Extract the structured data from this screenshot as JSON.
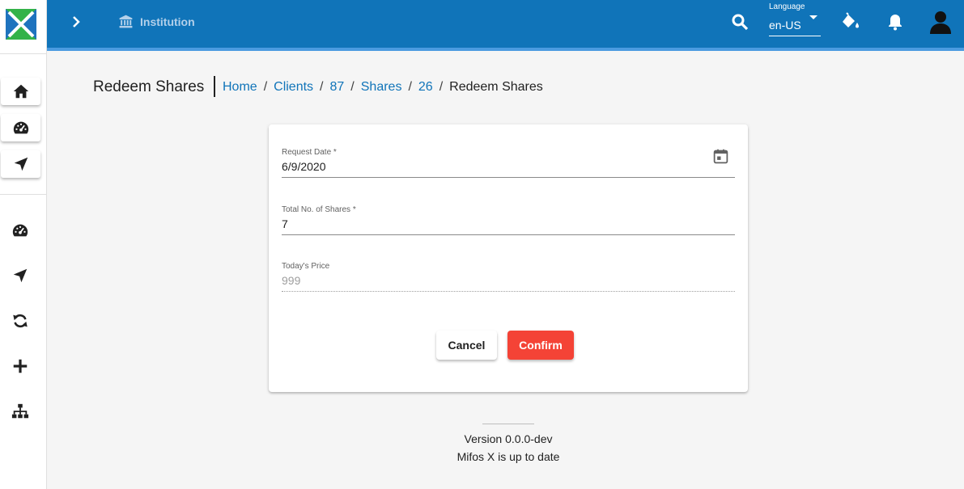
{
  "app": {
    "brand_colors": {
      "primary": "#1074b9",
      "accent": "#f44336",
      "logo_blue": "#1e73be",
      "logo_green": "#33b249"
    }
  },
  "sidebar": {
    "favorites": [
      {
        "icon": "home-icon"
      },
      {
        "icon": "dashboard-icon"
      },
      {
        "icon": "navigation-icon"
      }
    ],
    "nav": [
      {
        "icon": "dashboard-icon"
      },
      {
        "icon": "navigation-icon"
      },
      {
        "icon": "sync-icon"
      },
      {
        "icon": "plus-icon"
      },
      {
        "icon": "sitemap-icon"
      }
    ]
  },
  "topbar": {
    "institution_label": "Institution",
    "language": {
      "label": "Language",
      "value": "en-US"
    }
  },
  "page": {
    "title": "Redeem Shares",
    "breadcrumb": {
      "links": [
        "Home",
        "Clients",
        "87",
        "Shares",
        "26"
      ],
      "current": "Redeem Shares"
    }
  },
  "form": {
    "request_date": {
      "label": "Request Date *",
      "value": "6/9/2020"
    },
    "total_shares": {
      "label": "Total No. of Shares *",
      "value": "7"
    },
    "todays_price": {
      "label": "Today's Price",
      "value": "999"
    },
    "cancel_label": "Cancel",
    "confirm_label": "Confirm"
  },
  "footer": {
    "version": "Version 0.0.0-dev",
    "status": "Mifos X is up to date"
  }
}
